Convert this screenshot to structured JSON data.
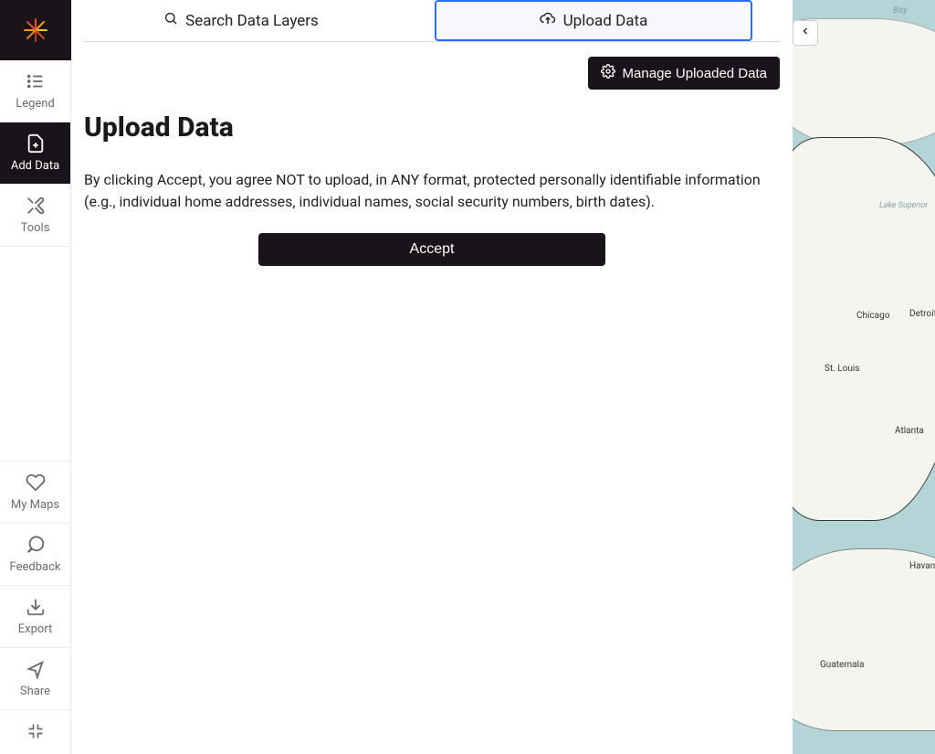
{
  "sidebar": {
    "top": [
      {
        "id": "legend",
        "label": "Legend",
        "icon": "list"
      },
      {
        "id": "add-data",
        "label": "Add Data",
        "icon": "add-file",
        "active": true
      },
      {
        "id": "tools",
        "label": "Tools",
        "icon": "tools"
      }
    ],
    "bottom": [
      {
        "id": "my-maps",
        "label": "My Maps",
        "icon": "heart"
      },
      {
        "id": "feedback",
        "label": "Feedback",
        "icon": "chat"
      },
      {
        "id": "export",
        "label": "Export",
        "icon": "download"
      },
      {
        "id": "share",
        "label": "Share",
        "icon": "share"
      },
      {
        "id": "fullscreen",
        "label": "",
        "icon": "exit-fullscreen"
      }
    ]
  },
  "tabs": {
    "search": "Search Data Layers",
    "upload": "Upload Data",
    "active": "upload"
  },
  "manage_button": "Manage Uploaded Data",
  "page": {
    "title": "Upload Data",
    "disclaimer": "By clicking Accept, you agree NOT to upload, in ANY format, protected personally identifiable information (e.g., individual home addresses, individual names, social security numbers, birth dates).",
    "accept": "Accept"
  },
  "map": {
    "top_label": "Bay",
    "lake": "Lake Superior",
    "cities": [
      "Chicago",
      "Detroit",
      "St. Louis",
      "Atlanta",
      "Havana",
      "Guatemala"
    ]
  }
}
